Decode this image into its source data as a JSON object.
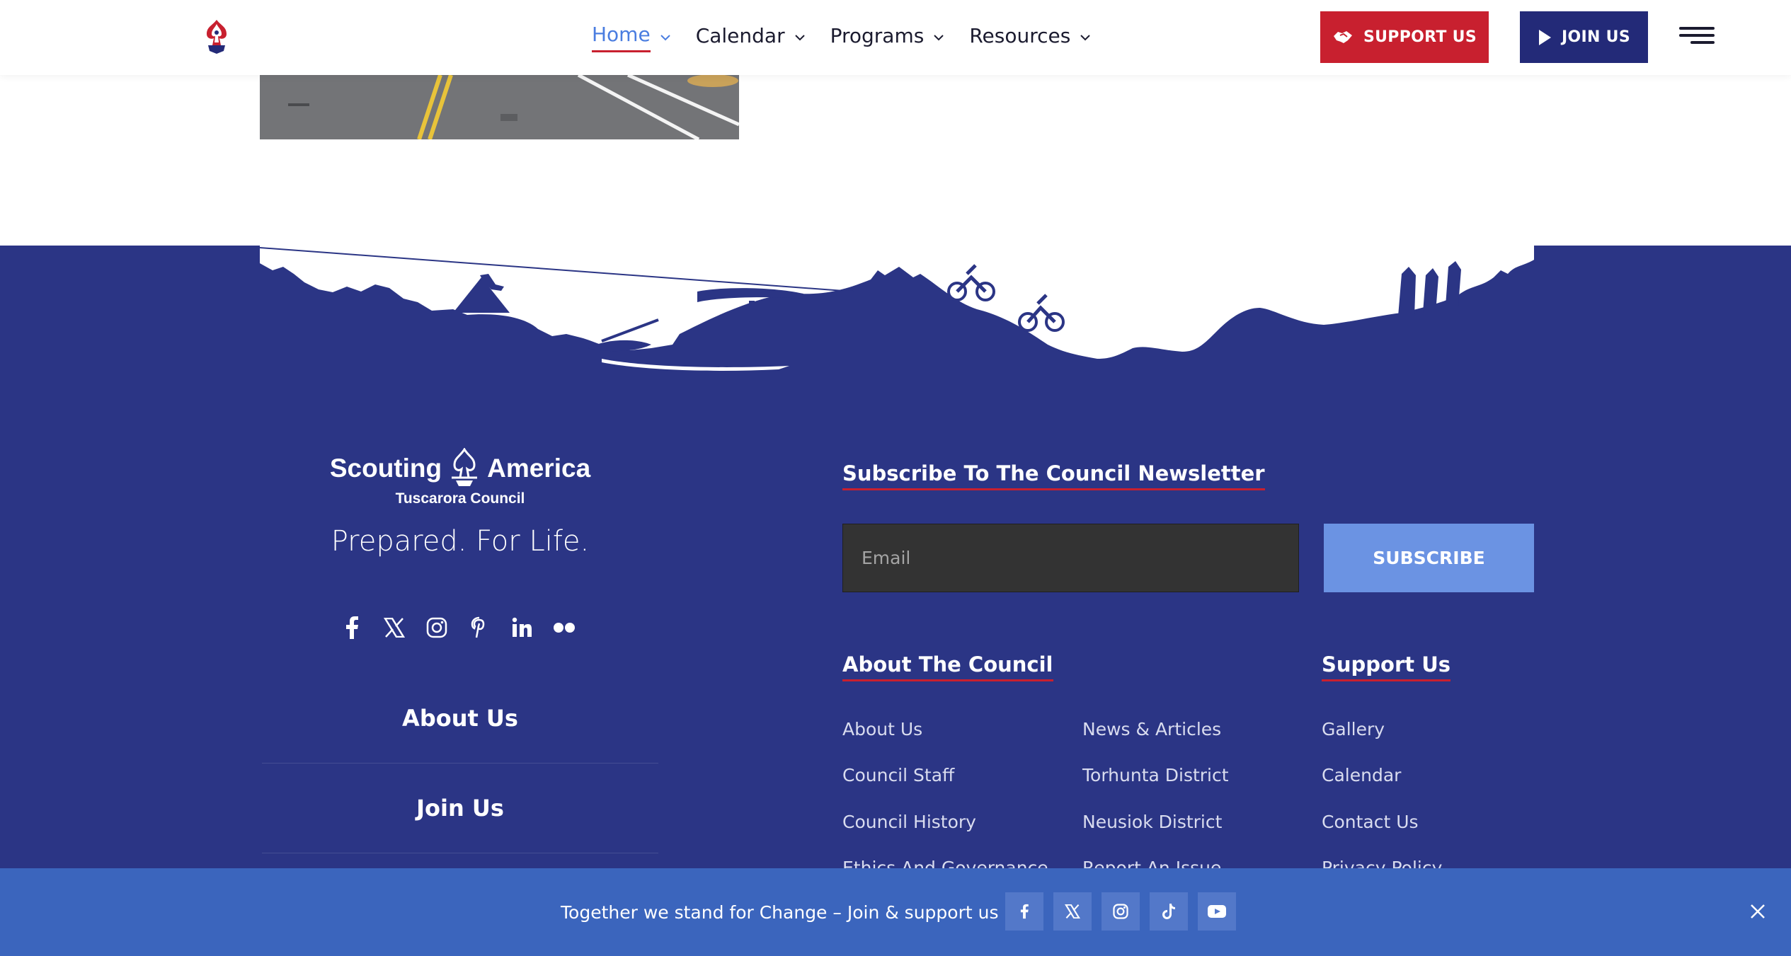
{
  "header": {
    "nav": [
      {
        "label": "Home",
        "active": true
      },
      {
        "label": "Calendar"
      },
      {
        "label": "Programs"
      },
      {
        "label": "Resources"
      }
    ],
    "support_label": "SUPPORT US",
    "join_label": "JOIN US"
  },
  "footer": {
    "brand": {
      "name_left": "Scouting",
      "name_right": "America",
      "council": "Tuscarora Council",
      "tagline": "Prepared. For Life."
    },
    "social_icons": [
      "facebook-icon",
      "x-icon",
      "instagram-icon",
      "pinterest-icon",
      "linkedin-icon",
      "flickr-icon"
    ],
    "left_links": [
      "About Us",
      "Join Us"
    ],
    "newsletter": {
      "title": "Subscribe To The Council Newsletter",
      "email_placeholder": "Email",
      "subscribe_label": "SUBSCRIBE"
    },
    "about": {
      "title": "About The Council",
      "col1": [
        "About Us",
        "Council Staff",
        "Council History",
        "Ethics And Governance"
      ],
      "col2": [
        "News & Articles",
        "Torhunta District",
        "Neusiok District",
        "Report An Issue"
      ]
    },
    "support": {
      "title": "Support Us",
      "links": [
        "Gallery",
        "Calendar",
        "Contact Us",
        "Privacy Policy"
      ]
    }
  },
  "notification_bar": {
    "text": "Together we stand for Change – Join & support us",
    "social_icons": [
      "facebook-icon",
      "x-icon",
      "instagram-icon",
      "tiktok-icon",
      "youtube-icon"
    ]
  },
  "colors": {
    "footer_bg": "#2b3585",
    "accent_red": "#c8202f",
    "navy": "#232a78",
    "link_blue": "#4a7de0",
    "bar_blue": "#3b65bd",
    "subscribe_blue": "#6b93e3"
  }
}
